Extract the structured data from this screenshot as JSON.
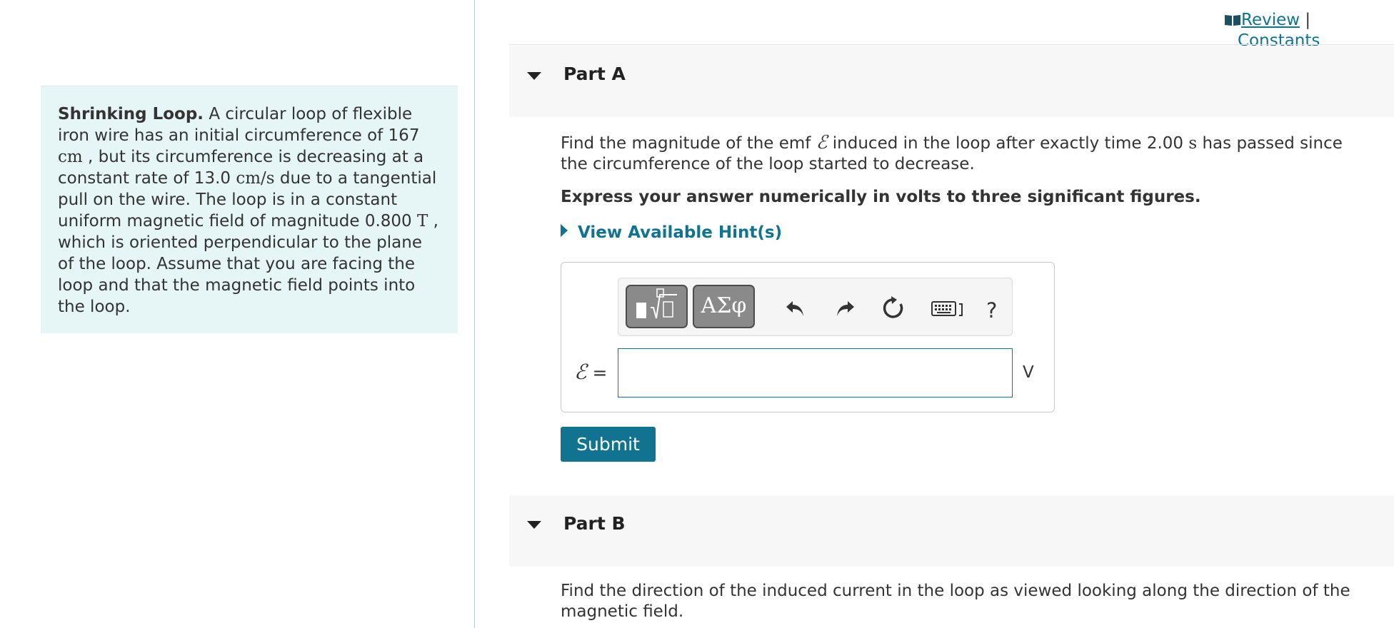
{
  "problem": {
    "title": "Shrinking Loop.",
    "seg1": " A circular loop of flexible iron wire has an initial circumference of 167 ",
    "unit_cm": "cm",
    "seg2": " , but its circumference is decreasing at a constant rate of 13.0 ",
    "unit_cms": "cm/s",
    "seg3": " due to a tangential pull on the wire. The loop is in a constant uniform magnetic field of magnitude 0.800 ",
    "unit_T": "T",
    "seg4": " , which is oriented perpendicular to the plane of the loop. Assume that you are facing the loop and that the magnetic field points into the loop."
  },
  "links": {
    "review": "Review",
    "separator": "|",
    "constants": "Constants"
  },
  "partA": {
    "title": "Part A",
    "q_seg1": "Find the magnitude of the emf ",
    "emf_symbol": "ℰ",
    "q_seg2": " induced in the loop after exactly time 2.00 ",
    "unit_s": "s",
    "q_seg3": " has passed since the circumference of the loop started to decrease.",
    "instruction": "Express your answer numerically in volts to three significant figures.",
    "hint_label": "View Available Hint(s)",
    "toolbar": {
      "greek_label": "ΑΣφ",
      "help_label": "?"
    },
    "answer": {
      "label_symbol": "ℰ",
      "label_eq": " =",
      "value": "",
      "unit": "V"
    },
    "submit_label": "Submit"
  },
  "partB": {
    "title": "Part B",
    "question": "Find the direction of the induced current in the loop as viewed looking along the direction of the magnetic field."
  },
  "colors": {
    "accent": "#11738f",
    "problem_bg": "#e6f5f5",
    "part_bar_bg": "#f7f7f7"
  }
}
